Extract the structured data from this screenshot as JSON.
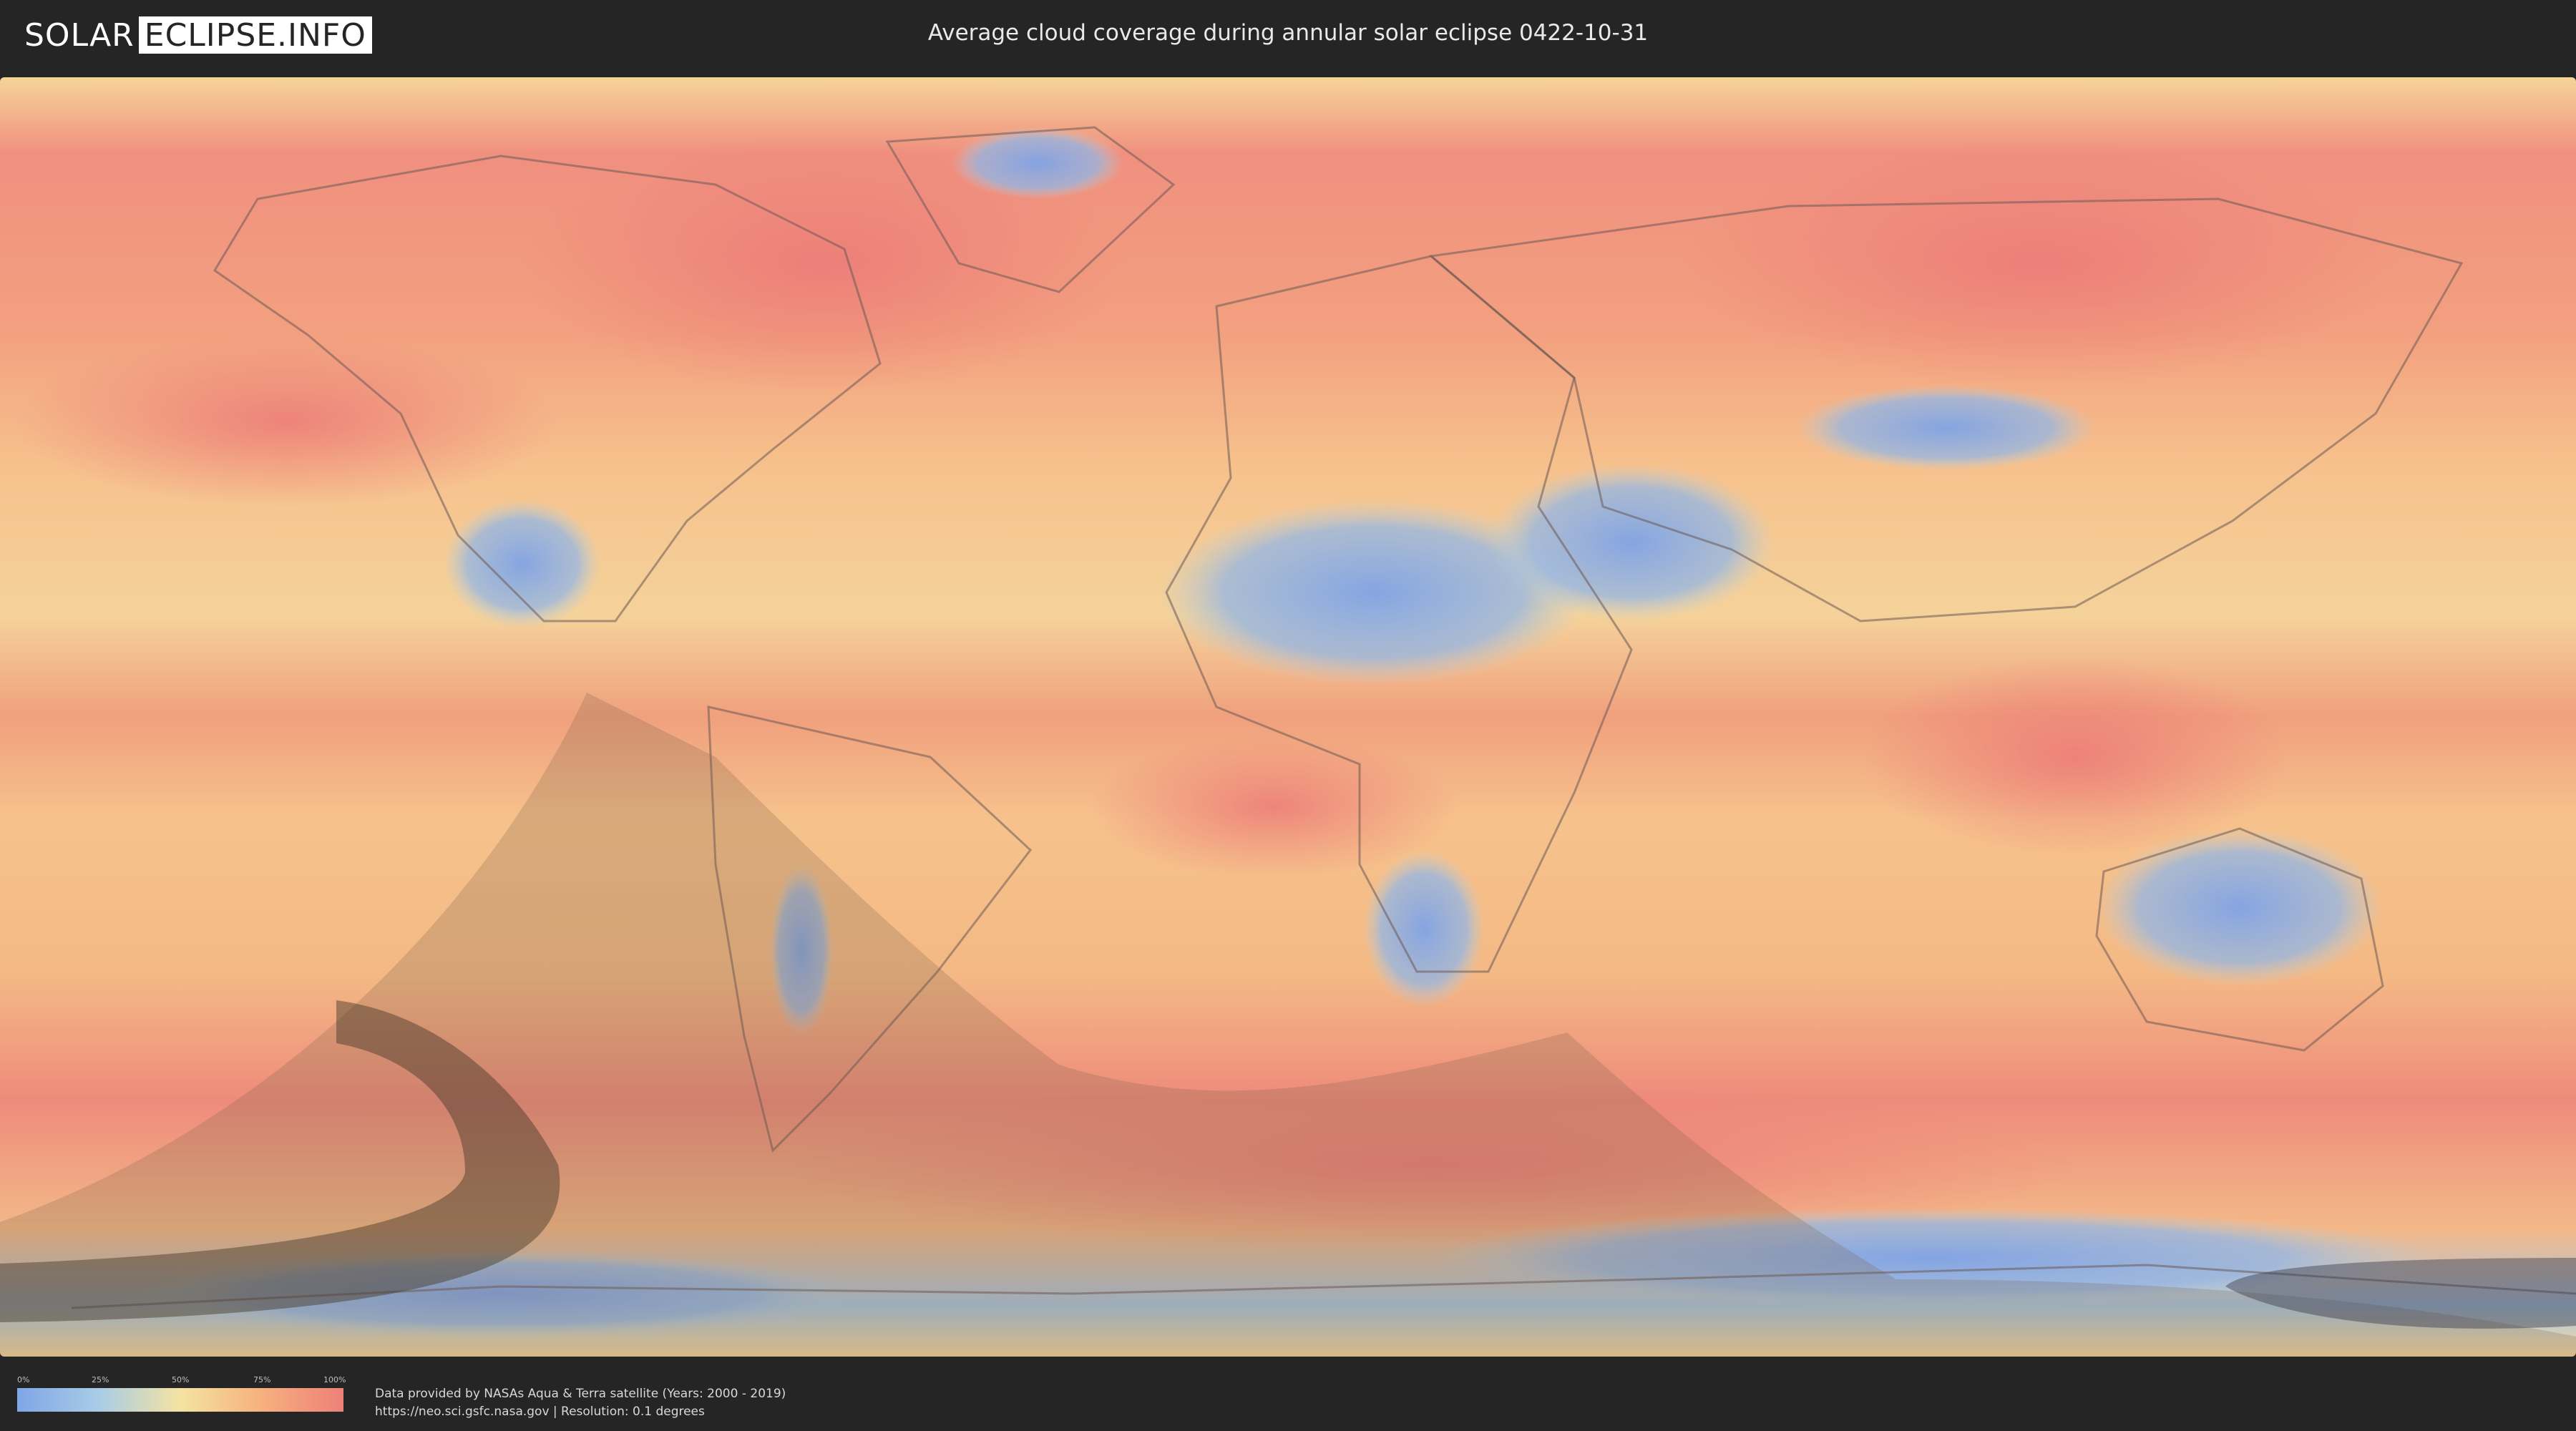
{
  "header": {
    "logo_part1": "SOLAR",
    "logo_part2": "ECLIPSE.INFO",
    "title": "Average cloud coverage during annular solar eclipse 0422-10-31"
  },
  "legend": {
    "ticks": [
      "0%",
      "25%",
      "50%",
      "75%",
      "100%"
    ],
    "colors": [
      "#7fa6e6",
      "#a9cce6",
      "#f4e3a2",
      "#f6b07e",
      "#ee8079"
    ]
  },
  "footer": {
    "credit_line1": "Data provided by NASAs Aqua & Terra satellite (Years: 2000 - 2019)",
    "credit_line2": "https://neo.sci.gsfc.nasa.gov | Resolution: 0.1 degrees"
  },
  "colors": {
    "background": "#252525",
    "high_cloud": "#ee8079",
    "medium_cloud": "#f4c48e",
    "low_cloud": "#7fa6e6",
    "eclipse_shadow": "#5a4a38"
  }
}
